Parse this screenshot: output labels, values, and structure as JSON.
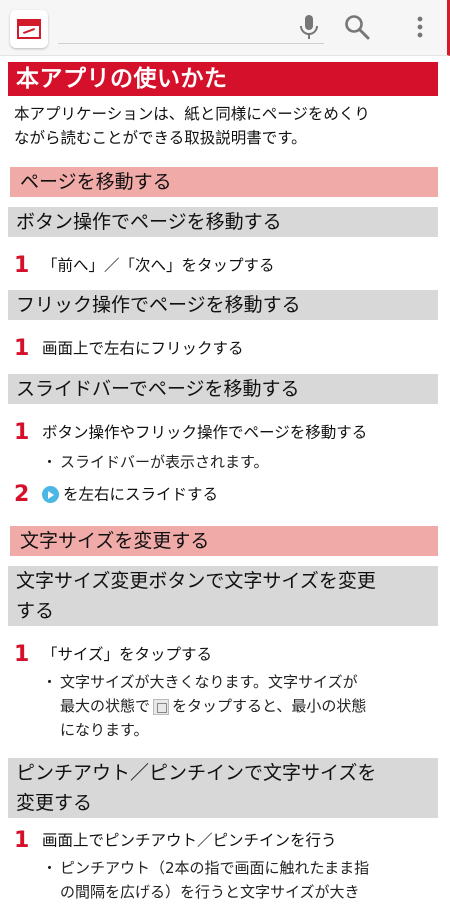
{
  "toolbar": {
    "app_icon": "manual-app-icon",
    "icons": [
      "mic-icon",
      "search-icon",
      "more-vert-icon"
    ],
    "accent": "#d21c2b"
  },
  "page": {
    "title": "本アプリの使いかた",
    "intro_line1": "本アプリケーションは、紙と同様にページをめくり",
    "intro_line2": "ながら読むことができる取扱説明書です。",
    "sections": [
      {
        "header": "ページを移動する",
        "subsections": [
          {
            "header": "ボタン操作でページを移動する",
            "steps": [
              {
                "num": "1",
                "text": "「前へ」／「次へ」をタップする"
              }
            ]
          },
          {
            "header": "フリック操作でページを移動する",
            "steps": [
              {
                "num": "1",
                "text": "画面上で左右にフリックする"
              }
            ]
          },
          {
            "header": "スライドバーでページを移動する",
            "steps": [
              {
                "num": "1",
                "text": "ボタン操作やフリック操作でページを移動する",
                "note": "スライドバーが表示されます。"
              },
              {
                "num": "2",
                "text": "を左右にスライドする"
              }
            ]
          }
        ]
      },
      {
        "header": "文字サイズを変更する",
        "subsections": [
          {
            "header_line1": "文字サイズ変更ボタンで文字サイズを変更",
            "header_line2": "する",
            "steps": [
              {
                "num": "1",
                "text": "「サイズ」をタップする",
                "note_line1": "文字サイズが大きくなります。文字サイズが",
                "note_line2a": "最大の状態で",
                "note_line2b": "をタップすると、最小の状態",
                "note_line3": "になります。"
              }
            ]
          },
          {
            "header_line1": "ピンチアウト／ピンチインで文字サイズを",
            "header_line2": "変更する",
            "steps": [
              {
                "num": "1",
                "text": "画面上でピンチアウト／ピンチインを行う",
                "note_line1": "ピンチアウト（2本の指で画面に触れたまま指",
                "note_line2": "の間隔を広げる）を行うと文字サイズが大き"
              }
            ]
          }
        ]
      }
    ]
  }
}
